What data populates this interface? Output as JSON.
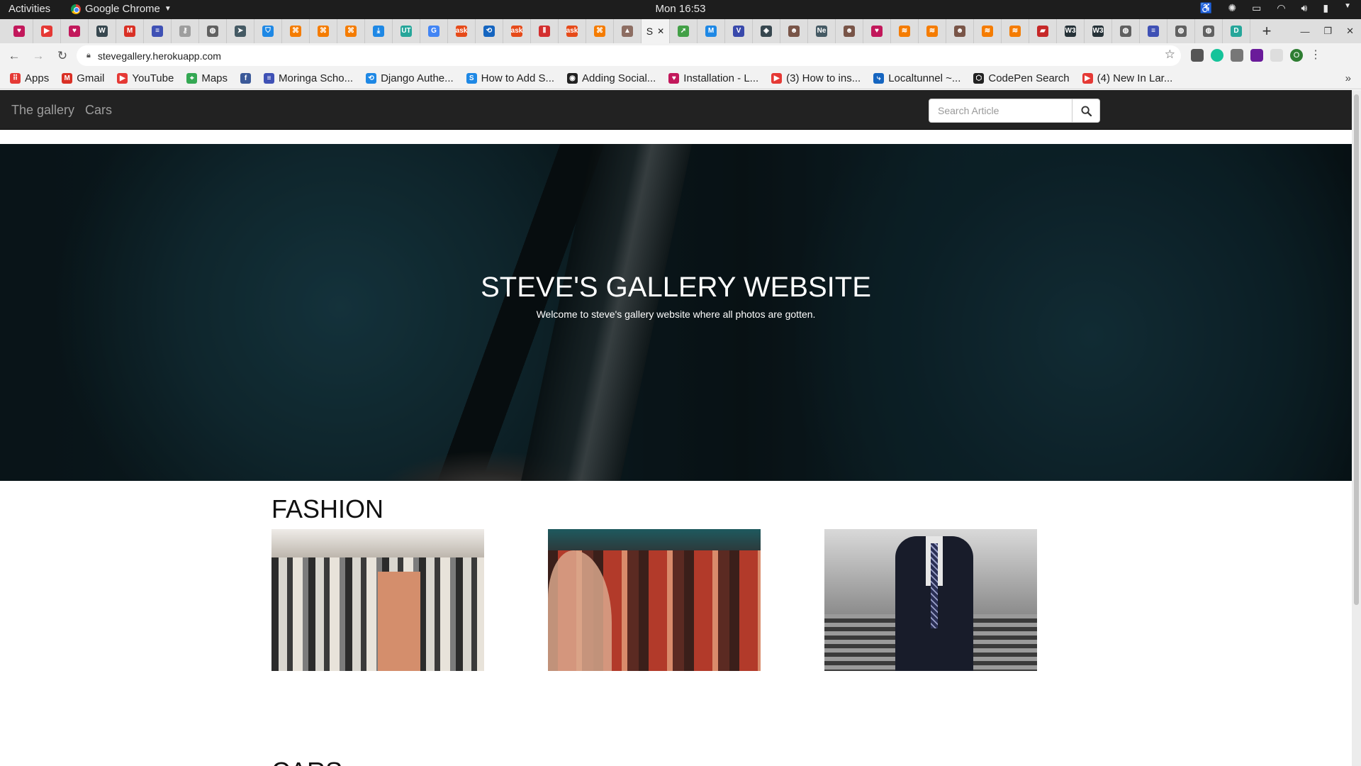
{
  "os_bar": {
    "activities": "Activities",
    "app_name": "Google Chrome",
    "clock": "Mon 16:53"
  },
  "tabs": {
    "favicons": [
      {
        "color": "#c2185b",
        "glyph": "♥"
      },
      {
        "color": "#e53935",
        "glyph": "▶"
      },
      {
        "color": "#c2185b",
        "glyph": "♥"
      },
      {
        "color": "#37474f",
        "glyph": "W"
      },
      {
        "color": "#d93025",
        "glyph": "M"
      },
      {
        "color": "#3f51b5",
        "glyph": "≡"
      },
      {
        "color": "#9e9e9e",
        "glyph": "⚷"
      },
      {
        "color": "#616161",
        "glyph": "◍"
      },
      {
        "color": "#455a64",
        "glyph": "➤"
      },
      {
        "color": "#1e88e5",
        "glyph": "⛉"
      },
      {
        "color": "#f57c00",
        "glyph": "⌘"
      },
      {
        "color": "#f57c00",
        "glyph": "⌘"
      },
      {
        "color": "#f57c00",
        "glyph": "⌘"
      },
      {
        "color": "#1e88e5",
        "glyph": "⤓"
      },
      {
        "color": "#26a69a",
        "glyph": "UT"
      },
      {
        "color": "#4285f4",
        "glyph": "G"
      },
      {
        "color": "#e64a19",
        "glyph": "ask"
      },
      {
        "color": "#1565c0",
        "glyph": "⟲"
      },
      {
        "color": "#e64a19",
        "glyph": "ask"
      },
      {
        "color": "#d32f2f",
        "glyph": "⫴"
      },
      {
        "color": "#e64a19",
        "glyph": "ask"
      },
      {
        "color": "#f57c00",
        "glyph": "⌘"
      },
      {
        "color": "#8d6e63",
        "glyph": "▲"
      }
    ],
    "active_label": "S",
    "active_close": "✕",
    "favicons_after": [
      {
        "color": "#43a047",
        "glyph": "➚"
      },
      {
        "color": "#1e88e5",
        "glyph": "M"
      },
      {
        "color": "#3949ab",
        "glyph": "V"
      },
      {
        "color": "#37474f",
        "glyph": "◈"
      },
      {
        "color": "#795548",
        "glyph": "☻"
      },
      {
        "color": "#455a64",
        "glyph": "Ne"
      },
      {
        "color": "#795548",
        "glyph": "☻"
      },
      {
        "color": "#c2185b",
        "glyph": "♥"
      },
      {
        "color": "#f57c00",
        "glyph": "≋"
      },
      {
        "color": "#f57c00",
        "glyph": "≋"
      },
      {
        "color": "#795548",
        "glyph": "☻"
      },
      {
        "color": "#f57c00",
        "glyph": "≋"
      },
      {
        "color": "#f57c00",
        "glyph": "≋"
      },
      {
        "color": "#c62828",
        "glyph": "▰"
      },
      {
        "color": "#263238",
        "glyph": "W3"
      },
      {
        "color": "#263238",
        "glyph": "W3"
      },
      {
        "color": "#616161",
        "glyph": "◍"
      },
      {
        "color": "#3f51b5",
        "glyph": "≡"
      },
      {
        "color": "#616161",
        "glyph": "◍"
      },
      {
        "color": "#616161",
        "glyph": "◍"
      },
      {
        "color": "#26a69a",
        "glyph": "D"
      }
    ],
    "new_tab": "+"
  },
  "toolbar": {
    "url": "stevegallery.herokuapp.com",
    "profile_initial": "O"
  },
  "bookmarks": [
    {
      "label": "Apps",
      "color": "#e53935",
      "glyph": "⠿"
    },
    {
      "label": "Gmail",
      "color": "#d93025",
      "glyph": "M"
    },
    {
      "label": "YouTube",
      "color": "#e53935",
      "glyph": "▶"
    },
    {
      "label": "Maps",
      "color": "#34a853",
      "glyph": "⌖"
    },
    {
      "label": "",
      "color": "#3b5998",
      "glyph": "f"
    },
    {
      "label": "Moringa Scho...",
      "color": "#3f51b5",
      "glyph": "≡"
    },
    {
      "label": "Django Authe...",
      "color": "#1e88e5",
      "glyph": "⟲"
    },
    {
      "label": "How to Add S...",
      "color": "#1e88e5",
      "glyph": "S"
    },
    {
      "label": "Adding Social...",
      "color": "#212121",
      "glyph": "◉"
    },
    {
      "label": "Installation - L...",
      "color": "#c2185b",
      "glyph": "♥"
    },
    {
      "label": "(3) How to ins...",
      "color": "#e53935",
      "glyph": "▶"
    },
    {
      "label": "Localtunnel ~...",
      "color": "#1565c0",
      "glyph": "⤷"
    },
    {
      "label": "CodePen Search",
      "color": "#212121",
      "glyph": "⬡"
    },
    {
      "label": "(4) New In Lar...",
      "color": "#e53935",
      "glyph": "▶"
    }
  ],
  "bookmarks_more": "»",
  "site": {
    "brand": "The gallery",
    "nav_link": "Cars",
    "search_placeholder": "Search Article",
    "hero_title": "STEVE'S GALLERY WEBSITE",
    "hero_subtitle": "Welcome to steve's gallery website where all photos are gotten.",
    "section_fashion": "FASHION",
    "section_cars": "CARS"
  }
}
